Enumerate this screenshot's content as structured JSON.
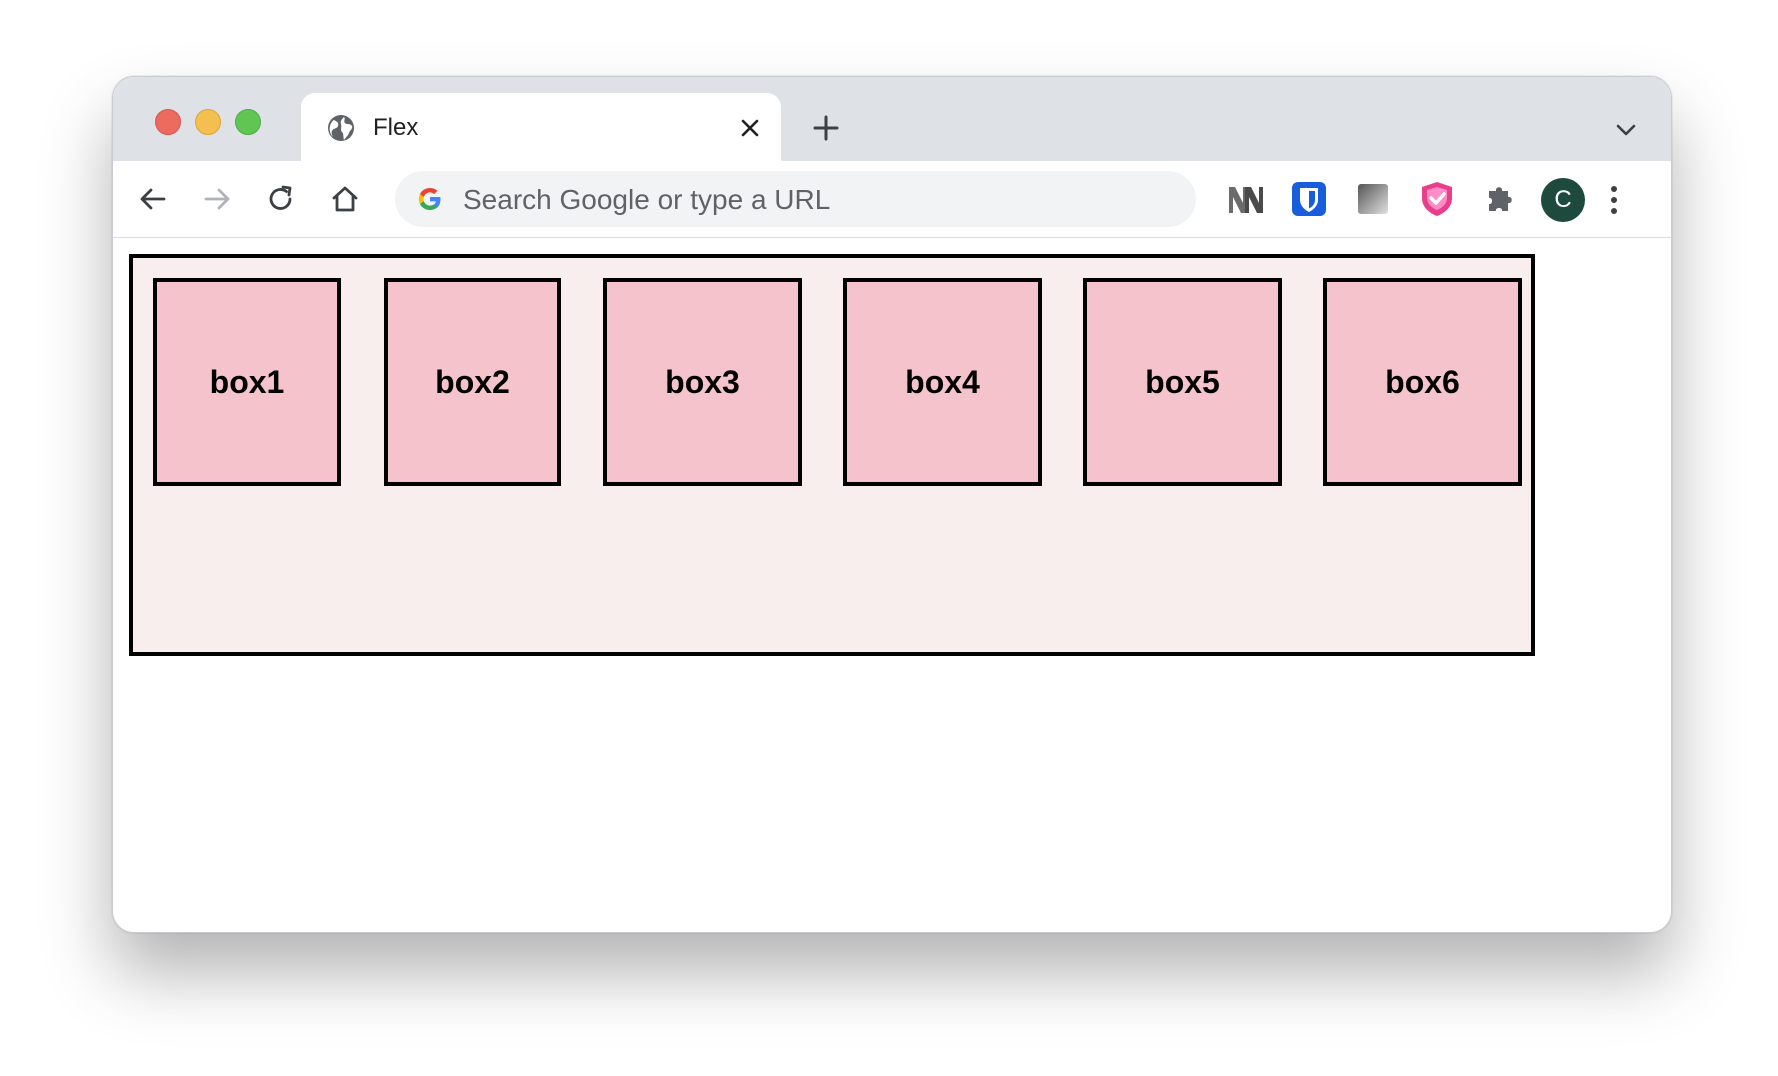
{
  "browser": {
    "tab": {
      "title": "Flex",
      "icon": "globe-icon",
      "close_icon": "close-icon"
    },
    "new_tab_icon": "plus-icon",
    "tab_search_icon": "chevron-down-icon",
    "toolbar": {
      "back_icon": "arrow-left-icon",
      "forward_icon": "arrow-right-icon",
      "reload_icon": "reload-icon",
      "home_icon": "home-icon",
      "omnibox": {
        "placeholder": "Search Google or type a URL",
        "icon": "google-icon"
      },
      "extensions": [
        "nn-extension-icon",
        "bitwarden-icon",
        "gradient-extension-icon",
        "shield-heart-icon",
        "puzzle-icon"
      ],
      "profile_initial": "C",
      "menu_icon": "kebab-menu-icon"
    }
  },
  "colors": {
    "container_bg": "#f8eeee",
    "box_bg": "#f5c3cb",
    "border": "#000000",
    "avatar_bg": "#1d4a3d"
  },
  "page": {
    "boxes": [
      {
        "label": "box1"
      },
      {
        "label": "box2"
      },
      {
        "label": "box3"
      },
      {
        "label": "box4"
      },
      {
        "label": "box5"
      },
      {
        "label": "box6"
      }
    ]
  }
}
